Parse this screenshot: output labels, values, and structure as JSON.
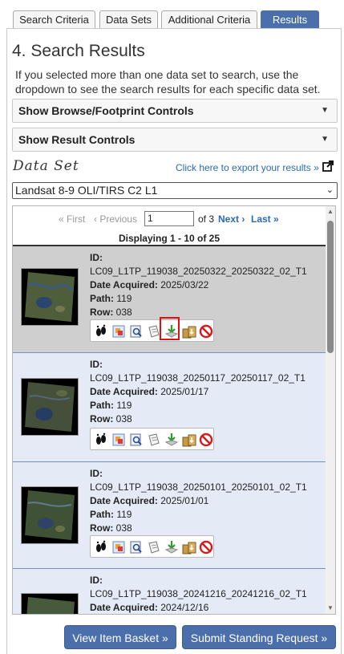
{
  "tabs": [
    {
      "label": "Search Criteria"
    },
    {
      "label": "Data Sets"
    },
    {
      "label": "Additional Criteria"
    },
    {
      "label": "Results"
    }
  ],
  "heading": "4. Search Results",
  "intro": "If you selected more than one data set to search, use the dropdown to see the search results for each specific data set.",
  "browse_controls_label": "Show Browse/Footprint Controls",
  "result_controls_label": "Show Result Controls",
  "dataset_label": "Data Set",
  "export_link": "Click here to export your results »",
  "dataset_selected": "Landsat 8-9 OLI/TIRS C2 L1",
  "pager": {
    "first": "« First",
    "previous": "‹ Previous",
    "page_value": "1",
    "of_pages": "of 3",
    "next": "Next ›",
    "last": "Last »"
  },
  "displaying": "Displaying 1 - 10 of 25",
  "results": [
    {
      "id_label": "ID:",
      "id": "LC09_L1TP_119038_20250322_20250322_02_T1",
      "date_label": "Date Acquired:",
      "date": "2025/03/22",
      "path_label": "Path:",
      "path": "119",
      "row_label": "Row:",
      "row": "038"
    },
    {
      "id_label": "ID:",
      "id": "LC09_L1TP_119038_20250117_20250117_02_T1",
      "date_label": "Date Acquired:",
      "date": "2025/01/17",
      "path_label": "Path:",
      "path": "119",
      "row_label": "Row:",
      "row": "038"
    },
    {
      "id_label": "ID:",
      "id": "LC09_L1TP_119038_20250101_20250101_02_T1",
      "date_label": "Date Acquired:",
      "date": "2025/01/01",
      "path_label": "Path:",
      "path": "119",
      "row_label": "Row:",
      "row": "038"
    },
    {
      "id_label": "ID:",
      "id": "LC09_L1TP_119038_20241216_20241216_02_T1",
      "date_label": "Date Acquired:",
      "date": "2024/12/16"
    }
  ],
  "tool_icons": [
    "footprint-icon",
    "overlay-icon",
    "metadata-icon",
    "compare-icon",
    "download-icon",
    "bulk-download-icon",
    "exclude-icon"
  ],
  "buttons": {
    "item_basket": "View Item Basket »",
    "standing_request": "Submit Standing Request »"
  },
  "colors": {
    "accent": "#4a6faa",
    "link": "#2a6ab7",
    "selected_row": "#cfcfcf",
    "row_bg": "#e4ebf7",
    "highlight": "#e01010"
  }
}
